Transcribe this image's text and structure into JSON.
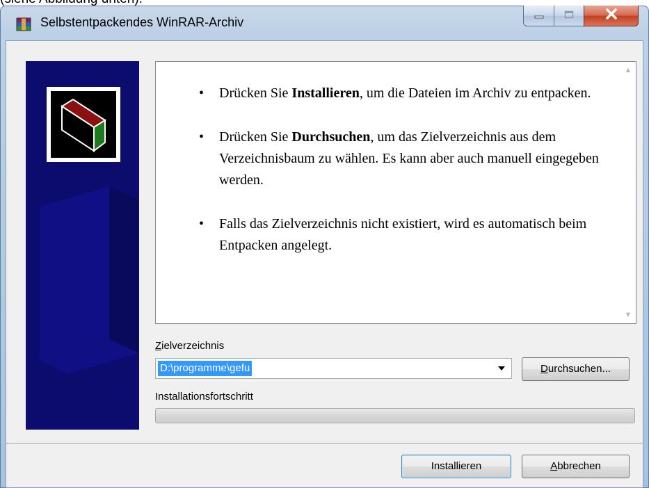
{
  "document": {
    "cropped_text": "(siehe Abbildung unten):"
  },
  "window": {
    "title": "Selbstentpackendes WinRAR-Archiv",
    "app_icon": "winrar-icon",
    "controls": {
      "minimize_icon": "minimize-icon",
      "maximize_icon": "maximize-icon",
      "close_icon": "close-icon"
    }
  },
  "instructions": {
    "items": [
      {
        "pre": "Drücken Sie ",
        "bold": "Installieren",
        "post": ", um die Dateien im Archiv zu entpacken."
      },
      {
        "pre": "Drücken Sie ",
        "bold": "Durchsuchen",
        "post": ", um das Zielverzeichnis aus dem Verzeichnisbaum zu wählen. Es kann aber auch manuell eingegeben werden."
      },
      {
        "pre": "",
        "bold": "",
        "post": "Falls das Zielverzeichnis nicht existiert, wird es automatisch beim Entpacken angelegt."
      }
    ],
    "bullet": "•"
  },
  "destination": {
    "label_first": "Z",
    "label_rest": "ielverzeichnis",
    "value": "D:\\programme\\gefu",
    "browse_first": "D",
    "browse_rest": "urchsuchen..."
  },
  "progress": {
    "label": "Installationsfortschritt",
    "value": 0
  },
  "buttons": {
    "install": "Installieren",
    "cancel_first": "A",
    "cancel_rest": "bbrechen"
  },
  "colors": {
    "banner": "#0c0c6e",
    "selection": "#3399ff",
    "close_button": "#c2401f"
  }
}
